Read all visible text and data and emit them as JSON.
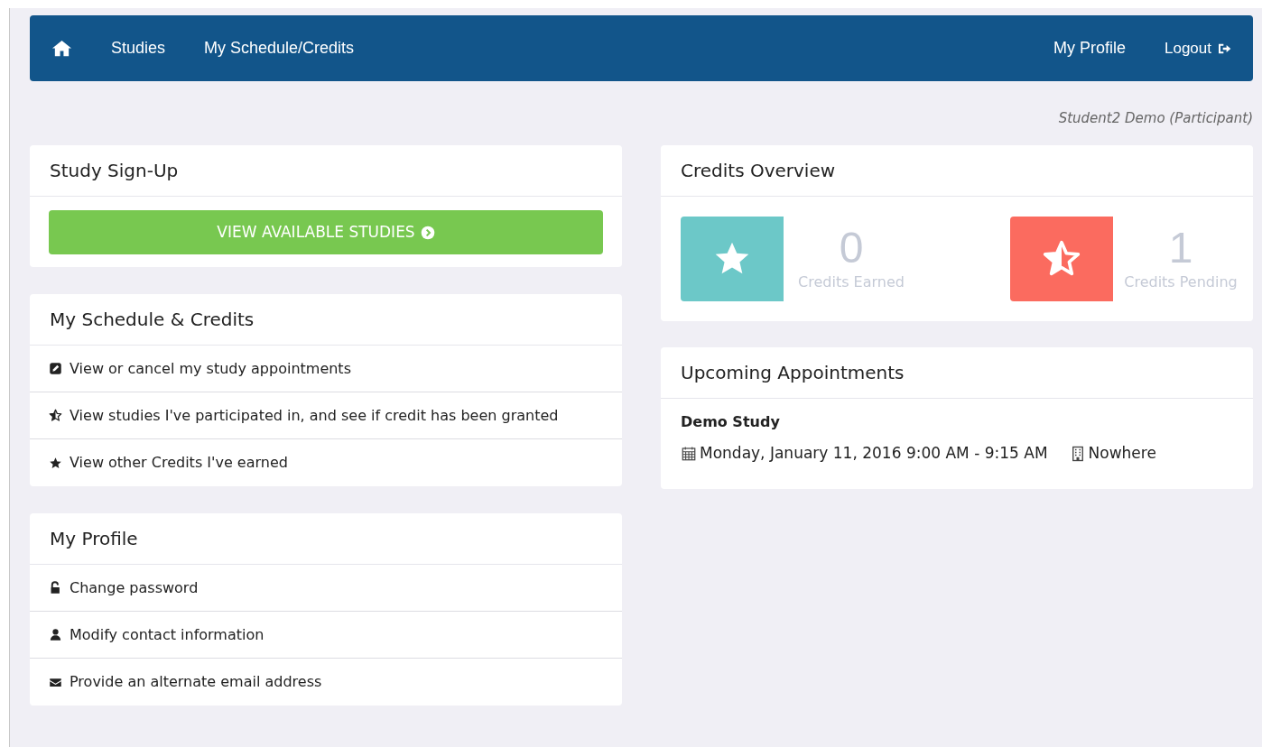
{
  "navbar": {
    "left": [
      {
        "kind": "home"
      },
      {
        "kind": "text",
        "label": "Studies"
      },
      {
        "kind": "text",
        "label": "My Schedule/Credits"
      }
    ],
    "right": [
      {
        "kind": "text",
        "label": "My Profile"
      },
      {
        "kind": "logout",
        "label": "Logout"
      }
    ]
  },
  "user": "Student2 Demo (Participant)",
  "left_panels": [
    {
      "title": "Study Sign-Up",
      "button": "VIEW AVAILABLE STUDIES"
    },
    {
      "title": "My Schedule & Credits",
      "items": [
        {
          "kind": "edit",
          "label": "View or cancel my study appointments"
        },
        {
          "kind": "half-star",
          "label": "View studies I've participated in, and see if credit has been granted"
        },
        {
          "kind": "star",
          "label": "View other Credits I've earned"
        }
      ]
    },
    {
      "title": "My Profile",
      "items": [
        {
          "kind": "unlock",
          "label": "Change password"
        },
        {
          "kind": "user",
          "label": "Modify contact information"
        },
        {
          "kind": "envelope",
          "label": "Provide an alternate email address"
        }
      ]
    }
  ],
  "credits_overview": {
    "title": "Credits Overview",
    "tiles": [
      {
        "kind": "star",
        "color": "#6cc8c8",
        "value": "0",
        "label": "Credits Earned"
      },
      {
        "kind": "half-star",
        "color": "#fb6b5f",
        "value": "1",
        "label": "Credits Pending"
      }
    ]
  },
  "upcoming": {
    "title": "Upcoming Appointments",
    "appointments": [
      {
        "study": "Demo Study",
        "when": "Monday, January 11, 2016 9:00 AM - 9:15 AM",
        "where": "Nowhere"
      }
    ]
  }
}
